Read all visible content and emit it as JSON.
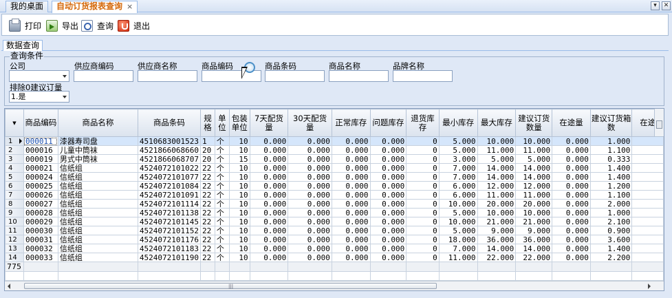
{
  "tabs": [
    {
      "label": "我的桌面",
      "active": false
    },
    {
      "label": "自动订货报表查询",
      "active": true
    }
  ],
  "tab_close": "×",
  "window_buttons": [
    "▾",
    "✕"
  ],
  "toolbar": {
    "print": "打印",
    "export": "导出",
    "query": "查询",
    "exit": "退出"
  },
  "panel_tab": "数据查询",
  "conditions": {
    "title": "查询条件",
    "company_label": "公司",
    "company_value": "",
    "supplier_code_label": "供应商编码",
    "supplier_name_label": "供应商名称",
    "product_code_label": "商品编码",
    "barcode_label": "商品条码",
    "product_name_label": "商品名称",
    "brand_name_label": "品牌名称",
    "exclude_zero_label": "排除0建议订量",
    "exclude_zero_value": "1.是"
  },
  "grid": {
    "columns": [
      "商品编码",
      "商品名称",
      "商品条码",
      "规格",
      "单位",
      "包装单位",
      "7天配货量",
      "30天配货量",
      "正常库存",
      "问题库存",
      "退货库存",
      "最小库存",
      "最大库存",
      "建议订货数量",
      "在途量",
      "建议订货箱数",
      "在途"
    ],
    "rows": [
      {
        "n": "1",
        "code": "000011",
        "name": "漆器寿司盘",
        "barcode": "4510683001523",
        "spec": "1",
        "unit": "个",
        "pack": "10",
        "d7": "0.000",
        "d30": "0.000",
        "normal": "0.000",
        "problem": "0.000",
        "ret": "0",
        "min": "5.000",
        "max": "10.000",
        "suggest": "10.000",
        "transit": "0.000",
        "boxes": "1.000"
      },
      {
        "n": "2",
        "code": "000016",
        "name": "儿童中筒袜",
        "barcode": "4521866068660",
        "spec": "20",
        "unit": "个",
        "pack": "10",
        "d7": "0.000",
        "d30": "0.000",
        "normal": "0.000",
        "problem": "0.000",
        "ret": "0",
        "min": "5.000",
        "max": "11.000",
        "suggest": "11.000",
        "transit": "0.000",
        "boxes": "1.100"
      },
      {
        "n": "3",
        "code": "000019",
        "name": "男式中筒袜",
        "barcode": "4521866068707",
        "spec": "20",
        "unit": "个",
        "pack": "15",
        "d7": "0.000",
        "d30": "0.000",
        "normal": "0.000",
        "problem": "0.000",
        "ret": "0",
        "min": "3.000",
        "max": "5.000",
        "suggest": "5.000",
        "transit": "0.000",
        "boxes": "0.333"
      },
      {
        "n": "4",
        "code": "000021",
        "name": "信纸组",
        "barcode": "4524072101022",
        "spec": "22",
        "unit": "个",
        "pack": "10",
        "d7": "0.000",
        "d30": "0.000",
        "normal": "0.000",
        "problem": "0.000",
        "ret": "0",
        "min": "7.000",
        "max": "14.000",
        "suggest": "14.000",
        "transit": "0.000",
        "boxes": "1.400"
      },
      {
        "n": "5",
        "code": "000024",
        "name": "信纸组",
        "barcode": "4524072101077",
        "spec": "22",
        "unit": "个",
        "pack": "10",
        "d7": "0.000",
        "d30": "0.000",
        "normal": "0.000",
        "problem": "0.000",
        "ret": "0",
        "min": "7.000",
        "max": "14.000",
        "suggest": "14.000",
        "transit": "0.000",
        "boxes": "1.400"
      },
      {
        "n": "6",
        "code": "000025",
        "name": "信纸组",
        "barcode": "4524072101084",
        "spec": "22",
        "unit": "个",
        "pack": "10",
        "d7": "0.000",
        "d30": "0.000",
        "normal": "0.000",
        "problem": "0.000",
        "ret": "0",
        "min": "6.000",
        "max": "12.000",
        "suggest": "12.000",
        "transit": "0.000",
        "boxes": "1.200"
      },
      {
        "n": "7",
        "code": "000026",
        "name": "信纸组",
        "barcode": "4524072101091",
        "spec": "22",
        "unit": "个",
        "pack": "10",
        "d7": "0.000",
        "d30": "0.000",
        "normal": "0.000",
        "problem": "0.000",
        "ret": "0",
        "min": "6.000",
        "max": "11.000",
        "suggest": "11.000",
        "transit": "0.000",
        "boxes": "1.100"
      },
      {
        "n": "8",
        "code": "000027",
        "name": "信纸组",
        "barcode": "4524072101114",
        "spec": "22",
        "unit": "个",
        "pack": "10",
        "d7": "0.000",
        "d30": "0.000",
        "normal": "0.000",
        "problem": "0.000",
        "ret": "0",
        "min": "10.000",
        "max": "20.000",
        "suggest": "20.000",
        "transit": "0.000",
        "boxes": "2.000"
      },
      {
        "n": "9",
        "code": "000028",
        "name": "信纸组",
        "barcode": "4524072101138",
        "spec": "22",
        "unit": "个",
        "pack": "10",
        "d7": "0.000",
        "d30": "0.000",
        "normal": "0.000",
        "problem": "0.000",
        "ret": "0",
        "min": "5.000",
        "max": "10.000",
        "suggest": "10.000",
        "transit": "0.000",
        "boxes": "1.000"
      },
      {
        "n": "10",
        "code": "000029",
        "name": "信纸组",
        "barcode": "4524072101145",
        "spec": "22",
        "unit": "个",
        "pack": "10",
        "d7": "0.000",
        "d30": "0.000",
        "normal": "0.000",
        "problem": "0.000",
        "ret": "0",
        "min": "10.000",
        "max": "21.000",
        "suggest": "21.000",
        "transit": "0.000",
        "boxes": "2.100"
      },
      {
        "n": "11",
        "code": "000030",
        "name": "信纸组",
        "barcode": "4524072101152",
        "spec": "22",
        "unit": "个",
        "pack": "10",
        "d7": "0.000",
        "d30": "0.000",
        "normal": "0.000",
        "problem": "0.000",
        "ret": "0",
        "min": "5.000",
        "max": "9.000",
        "suggest": "9.000",
        "transit": "0.000",
        "boxes": "0.900"
      },
      {
        "n": "12",
        "code": "000031",
        "name": "信纸组",
        "barcode": "4524072101176",
        "spec": "22",
        "unit": "个",
        "pack": "10",
        "d7": "0.000",
        "d30": "0.000",
        "normal": "0.000",
        "problem": "0.000",
        "ret": "0",
        "min": "18.000",
        "max": "36.000",
        "suggest": "36.000",
        "transit": "0.000",
        "boxes": "3.600"
      },
      {
        "n": "13",
        "code": "000032",
        "name": "信纸组",
        "barcode": "4524072101183",
        "spec": "22",
        "unit": "个",
        "pack": "10",
        "d7": "0.000",
        "d30": "0.000",
        "normal": "0.000",
        "problem": "0.000",
        "ret": "0",
        "min": "7.000",
        "max": "14.000",
        "suggest": "14.000",
        "transit": "0.000",
        "boxes": "1.400"
      },
      {
        "n": "14",
        "code": "000033",
        "name": "信纸组",
        "barcode": "4524072101190",
        "spec": "22",
        "unit": "个",
        "pack": "10",
        "d7": "0.000",
        "d30": "0.000",
        "normal": "0.000",
        "problem": "0.000",
        "ret": "0",
        "min": "11.000",
        "max": "22.000",
        "suggest": "22.000",
        "transit": "0.000",
        "boxes": "2.200"
      }
    ],
    "total_count": "775"
  },
  "icons": {
    "print": "printer-icon",
    "export": "export-icon",
    "query": "magnifier-icon",
    "exit": "power-icon",
    "lookup": "lookup-icon"
  }
}
